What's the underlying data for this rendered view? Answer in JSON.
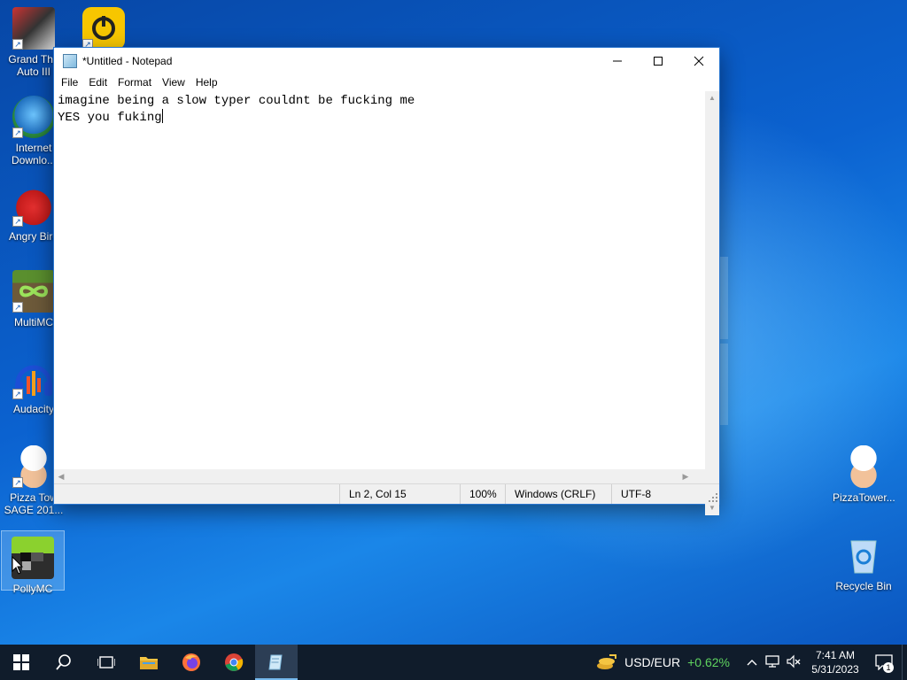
{
  "desktop": {
    "icons_left": [
      {
        "label": "Grand The Auto III",
        "line1": "Grand The",
        "line2": "Auto III"
      },
      {
        "label": "Internet Downlo...",
        "line1": "Internet",
        "line2": "Downlo..."
      },
      {
        "label": "Angry Bird",
        "line1": "Angry Bird",
        "line2": ""
      },
      {
        "label": "MultiMC",
        "line1": "MultiMC",
        "line2": ""
      },
      {
        "label": "Audacity",
        "line1": "Audacity",
        "line2": ""
      },
      {
        "label": "Pizza Tow SAGE 201...",
        "line1": "Pizza Tow",
        "line2": "SAGE 201..."
      },
      {
        "label": "PollyMC",
        "line1": "PollyMC",
        "line2": ""
      }
    ],
    "icons_right": [
      {
        "label": "PizzaTower..."
      },
      {
        "label": "Recycle Bin"
      }
    ]
  },
  "notepad": {
    "title": "*Untitled - Notepad",
    "menu": [
      "File",
      "Edit",
      "Format",
      "View",
      "Help"
    ],
    "lines": [
      "imagine being a slow typer couldnt be fucking me",
      "YES you fuking"
    ],
    "status": {
      "position": "Ln 2, Col 15",
      "zoom": "100%",
      "line_ending": "Windows (CRLF)",
      "encoding": "UTF-8"
    }
  },
  "taskbar": {
    "ticker_symbol": "USD/EUR",
    "ticker_change": "+0.62%",
    "time": "7:41 AM",
    "date": "5/31/2023",
    "notification_count": "1",
    "colors": {
      "ticker_positive": "#5fd35f",
      "background": "#101c2b"
    }
  }
}
